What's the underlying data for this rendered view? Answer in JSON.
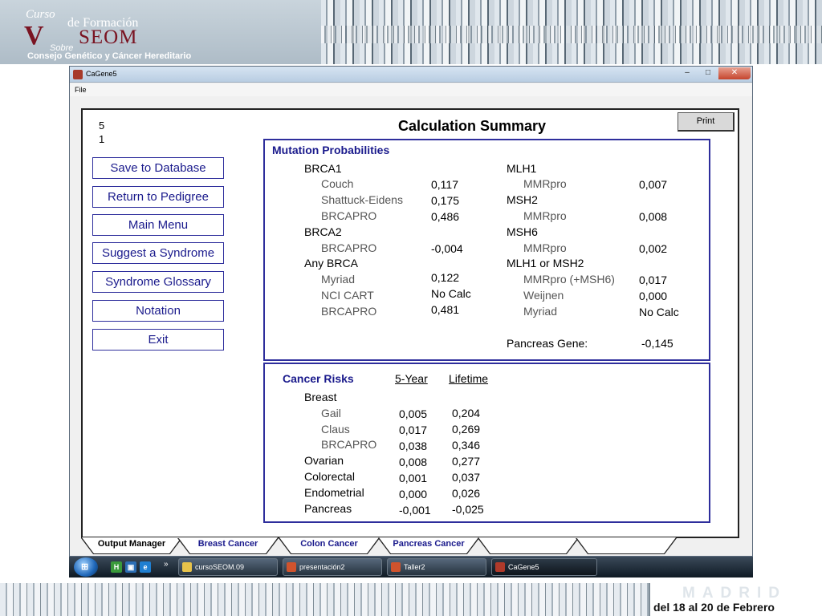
{
  "slide": {
    "logo_curso": "Curso",
    "logo_formacion": "de Formación",
    "logo_sobre": "Sobre",
    "logo_seom": "SEOM",
    "logo_consejo": "Consejo Genético y Cáncer Hereditario",
    "footer_city": "MADRID",
    "footer_dates": "del 18 al 20 de Febrero"
  },
  "window": {
    "title": "CaGene5",
    "menu_file": "File",
    "btn_minimize": "–",
    "btn_maximize": "□",
    "btn_close": "✕"
  },
  "counter": {
    "line1": "5",
    "line2": "1"
  },
  "nav": {
    "save": "Save to Database",
    "return": "Return to Pedigree",
    "main_menu": "Main Menu",
    "suggest": "Suggest a Syndrome",
    "glossary": "Syndrome Glossary",
    "notation": "Notation",
    "exit": "Exit"
  },
  "summary_title": "Calculation Summary",
  "print_label": "Print",
  "mutation": {
    "title": "Mutation Probabilities",
    "brca1": "BRCA1",
    "couch": "Couch",
    "couch_v": "0,117",
    "shattuck": "Shattuck-Eidens",
    "shattuck_v": "0,175",
    "brcapro1": "BRCAPRO",
    "brcapro1_v": "0,486",
    "brca2": "BRCA2",
    "brcapro2": "BRCAPRO",
    "brcapro2_v": "-0,004",
    "any_brca": "Any BRCA",
    "myriad1": "Myriad",
    "myriad1_v": "0,122",
    "nci": "NCI CART",
    "nci_v": "No Calc",
    "brcapro3": "BRCAPRO",
    "brcapro3_v": "0,481",
    "mlh1": "MLH1",
    "mmrpro1": "MMRpro",
    "mmrpro1_v": "0,007",
    "msh2": "MSH2",
    "mmrpro2": "MMRpro",
    "mmrpro2_v": "0,008",
    "msh6": "MSH6",
    "mmrpro3": "MMRpro",
    "mmrpro3_v": "0,002",
    "mlh1_or_msh2": "MLH1 or MSH2",
    "mmrpro4": "MMRpro (+MSH6)",
    "mmrpro4_v": "0,017",
    "weijnen": "Weijnen",
    "weijnen_v": "0,000",
    "myriad2": "Myriad",
    "myriad2_v": "No Calc",
    "pancreas_gene": "Pancreas Gene:",
    "pancreas_gene_v": "-0,145"
  },
  "risks": {
    "title": "Cancer Risks",
    "col_5y": "5-Year",
    "col_life": "Lifetime",
    "breast": "Breast",
    "rows": [
      {
        "label": "Gail",
        "five": "0,005",
        "life": "0,204"
      },
      {
        "label": "Claus",
        "five": "0,017",
        "life": "0,269"
      },
      {
        "label": "BRCAPRO",
        "five": "0,038",
        "life": "0,346"
      },
      {
        "label": "Ovarian",
        "five": "0,008",
        "life": "0,277"
      },
      {
        "label": "Colorectal",
        "five": "0,001",
        "life": "0,037"
      },
      {
        "label": "Endometrial",
        "five": "0,000",
        "life": "0,026"
      },
      {
        "label": "Pancreas",
        "five": "-0,001",
        "life": "-0,025"
      }
    ]
  },
  "tabs": [
    "Output Manager",
    "Breast Cancer",
    "Colon Cancer",
    "Pancreas Cancer",
    "",
    ""
  ],
  "taskbar": {
    "start": "⊞",
    "items": [
      "cursoSEOM.09",
      "presentación2",
      "Taller2",
      "CaGene5"
    ]
  }
}
